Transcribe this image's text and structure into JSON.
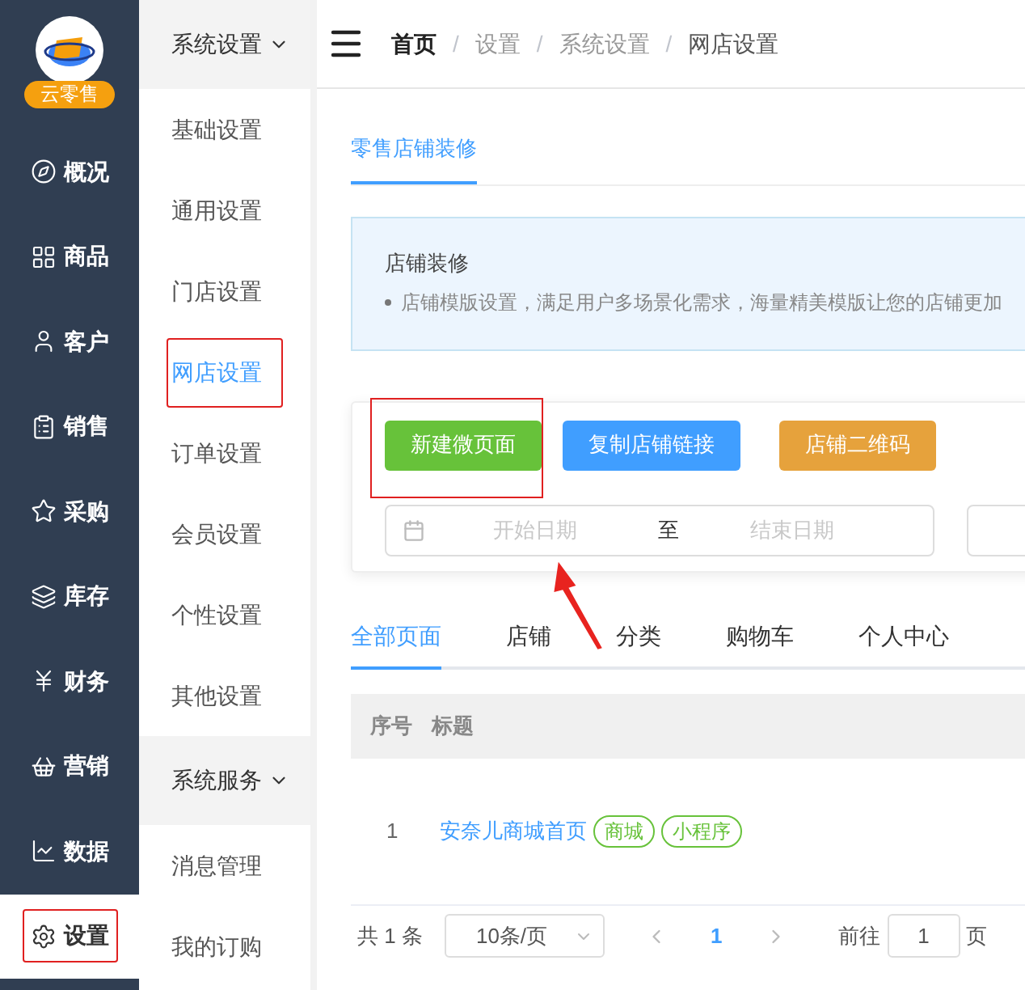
{
  "sidebar": {
    "logo_badge": "云零售",
    "items": [
      {
        "label": "概况",
        "selected": false,
        "annotated": false
      },
      {
        "label": "商品",
        "selected": false,
        "annotated": false
      },
      {
        "label": "客户",
        "selected": false,
        "annotated": false
      },
      {
        "label": "销售",
        "selected": false,
        "annotated": false
      },
      {
        "label": "采购",
        "selected": false,
        "annotated": false
      },
      {
        "label": "库存",
        "selected": false,
        "annotated": false
      },
      {
        "label": "财务",
        "selected": false,
        "annotated": false
      },
      {
        "label": "营销",
        "selected": false,
        "annotated": false
      },
      {
        "label": "数据",
        "selected": false,
        "annotated": false
      },
      {
        "label": "设置",
        "selected": true,
        "annotated": true
      }
    ]
  },
  "submenu": {
    "groups": [
      {
        "title": "系统设置",
        "expanded": true,
        "items": [
          {
            "label": "基础设置",
            "selected": false,
            "annotated": false
          },
          {
            "label": "通用设置",
            "selected": false,
            "annotated": false
          },
          {
            "label": "门店设置",
            "selected": false,
            "annotated": false
          },
          {
            "label": "网店设置",
            "selected": true,
            "annotated": true
          },
          {
            "label": "订单设置",
            "selected": false,
            "annotated": false
          },
          {
            "label": "会员设置",
            "selected": false,
            "annotated": false
          },
          {
            "label": "个性设置",
            "selected": false,
            "annotated": false
          },
          {
            "label": "其他设置",
            "selected": false,
            "annotated": false
          }
        ]
      },
      {
        "title": "系统服务",
        "expanded": true,
        "items": [
          {
            "label": "消息管理",
            "selected": false,
            "annotated": false
          },
          {
            "label": "我的订购",
            "selected": false,
            "annotated": false
          }
        ]
      }
    ]
  },
  "breadcrumb": [
    "首页",
    "设置",
    "系统设置",
    "网店设置"
  ],
  "breadcrumb_separator": "/",
  "page_tabs": [
    {
      "label": "零售店铺装修",
      "selected": true
    }
  ],
  "notice": {
    "title": "店铺装修",
    "bullet": "店铺模版设置，满足用户多场景化需求，海量精美模版让您的店铺更加"
  },
  "actions": [
    {
      "label": "新建微页面",
      "color": "#67c23a",
      "annotated": true
    },
    {
      "label": "复制店铺链接",
      "color": "#409eff",
      "annotated": false
    },
    {
      "label": "店铺二维码",
      "color": "#e6a23c",
      "annotated": false
    }
  ],
  "date_range": {
    "start_placeholder": "开始日期",
    "separator": "至",
    "end_placeholder": "结束日期"
  },
  "filter_tabs": [
    {
      "label": "全部页面",
      "selected": true
    },
    {
      "label": "店铺",
      "selected": false
    },
    {
      "label": "分类",
      "selected": false
    },
    {
      "label": "购物车",
      "selected": false
    },
    {
      "label": "个人中心",
      "selected": false
    }
  ],
  "table": {
    "columns": [
      "序号",
      "标题"
    ],
    "rows": [
      {
        "index": "1",
        "title": "安奈儿商城首页",
        "tags": [
          "商城",
          "小程序"
        ]
      }
    ]
  },
  "pagination": {
    "total": "共 1 条",
    "page_size": "10条/页",
    "pages": [
      {
        "label": "1",
        "selected": true
      }
    ],
    "goto_label": "前往",
    "goto_value": "1",
    "page_suffix": "页"
  }
}
